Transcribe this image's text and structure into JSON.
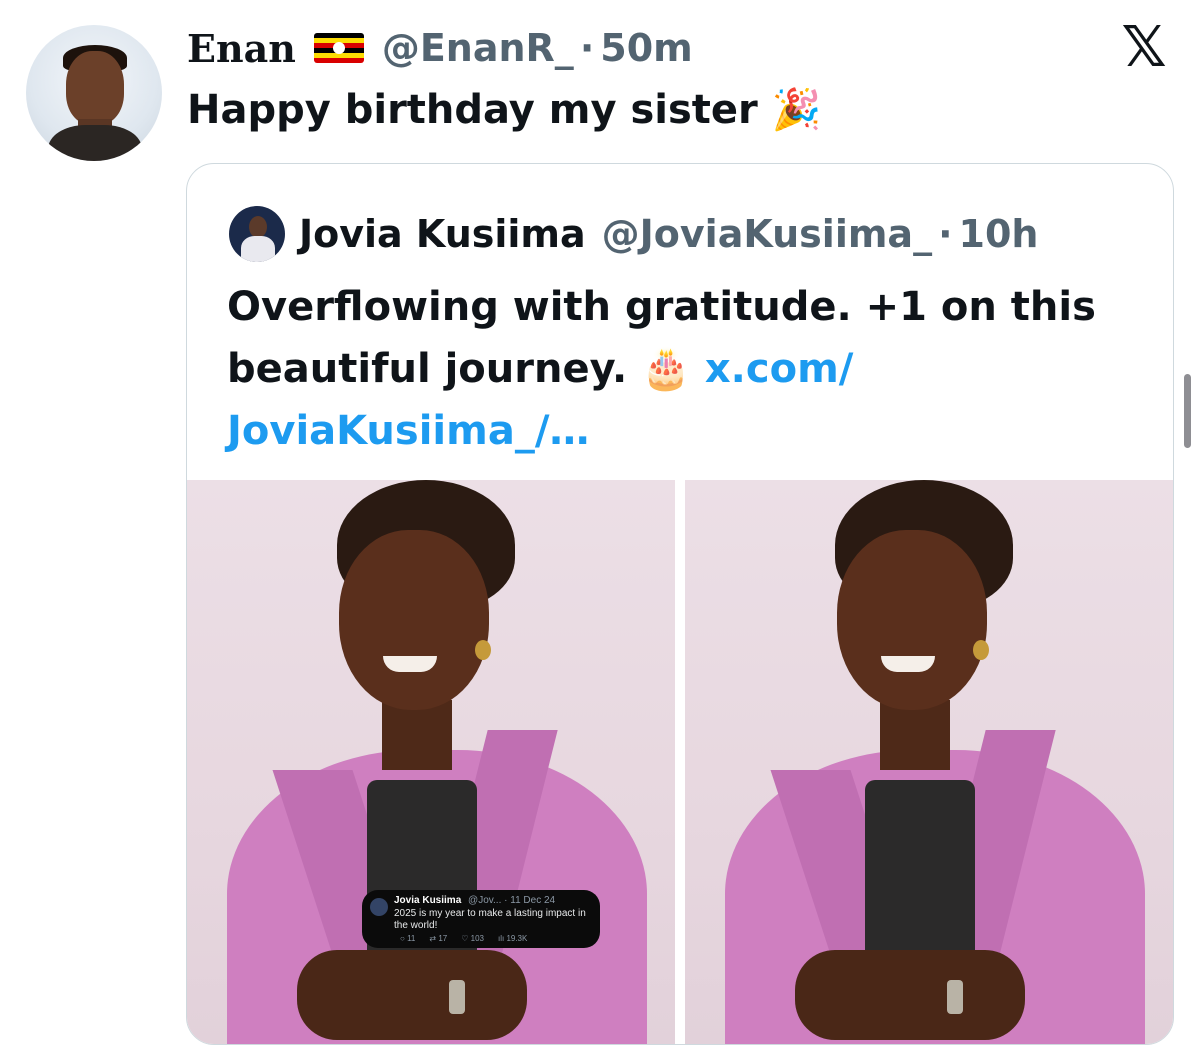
{
  "tweet": {
    "author_name": "Enan",
    "author_flag": "uganda-flag-emoji",
    "handle": "@EnanR_",
    "separator": "·",
    "time": "50m",
    "text": "Happy birthday my sister",
    "text_emoji": "🎉",
    "close_icon": "x-logo-icon"
  },
  "quote": {
    "author_name": "Jovia Kusiima",
    "handle": "@JoviaKusiima_",
    "separator": "·",
    "time": "10h",
    "text_line1": "Overflowing with gratitude. +1 on this",
    "text_line2_start": "beautiful journey.",
    "text_emoji": "🎂",
    "link_part1": "x.com/",
    "link_part2": "JoviaKusiima_/…",
    "images": [
      {
        "name": "photo-left",
        "description": "woman-in-pink-blazer"
      },
      {
        "name": "photo-right",
        "description": "woman-in-pink-blazer"
      }
    ],
    "embedded_card": {
      "author_name": "Jovia Kusiima",
      "handle": "@Jov...",
      "date": "· 11 Dec 24",
      "text": "2025 is my year to make a lasting impact in the world!",
      "replies": "11",
      "reposts": "17",
      "likes": "103",
      "views": "19.3K"
    }
  },
  "colors": {
    "text_primary": "#0f1419",
    "text_secondary": "#536471",
    "link": "#1d9bf0",
    "border": "#cfd9de",
    "jacket": "#cf7fc0"
  }
}
